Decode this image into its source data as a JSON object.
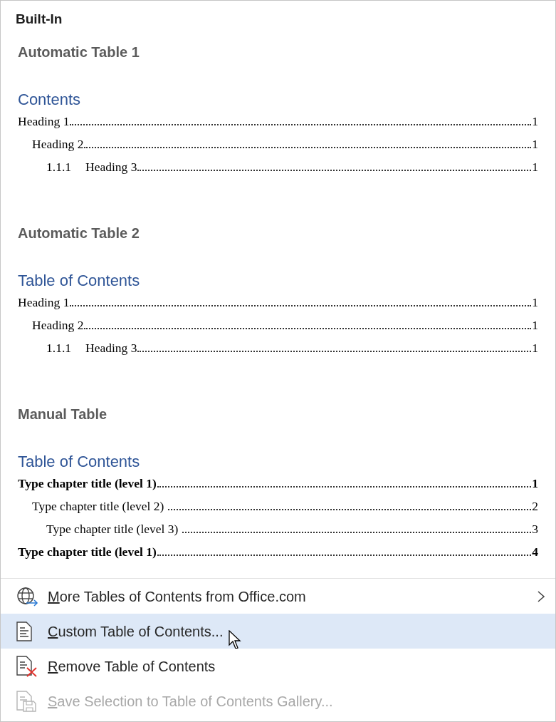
{
  "header": "Built-In",
  "sections": [
    {
      "title": "Automatic Table 1",
      "toc_title": "Contents",
      "entries": [
        {
          "text": "Heading 1",
          "page": "1",
          "bold": false,
          "children": [
            {
              "text": "Heading 2",
              "page": "1",
              "bold": false,
              "children": [
                {
                  "number": "1.1.1",
                  "text": "Heading 3",
                  "page": "1",
                  "bold": false
                }
              ]
            }
          ]
        }
      ]
    },
    {
      "title": "Automatic Table 2",
      "toc_title": "Table of Contents",
      "entries": [
        {
          "text": "Heading 1",
          "page": "1",
          "bold": false,
          "children": [
            {
              "text": "Heading 2",
              "page": "1",
              "bold": false,
              "children": [
                {
                  "number": "1.1.1",
                  "text": "Heading 3",
                  "page": "1",
                  "bold": false
                }
              ]
            }
          ]
        }
      ]
    },
    {
      "title": "Manual Table",
      "toc_title": "Table of Contents",
      "entries": [
        {
          "text": "Type chapter title (level 1)",
          "page": "1",
          "bold": true,
          "children": [
            {
              "text": "Type chapter title (level 2) ",
              "page": "2",
              "bold": false,
              "children": [
                {
                  "text": "Type chapter title (level 3) ",
                  "page": "3",
                  "bold": false
                }
              ]
            }
          ]
        },
        {
          "text": "Type chapter title (level 1)",
          "page": "4",
          "bold": true
        }
      ]
    }
  ],
  "menu": [
    {
      "kind": "globe",
      "label": "More Tables of Contents from Office.com",
      "submenu": true,
      "selected": false,
      "disabled": false
    },
    {
      "kind": "document",
      "label": "Custom Table of Contents...",
      "submenu": false,
      "selected": true,
      "disabled": false
    },
    {
      "kind": "remove",
      "label": "Remove Table of Contents",
      "submenu": false,
      "selected": false,
      "disabled": false
    },
    {
      "kind": "save",
      "label": "Save Selection to Table of Contents Gallery...",
      "submenu": false,
      "selected": false,
      "disabled": true
    }
  ]
}
